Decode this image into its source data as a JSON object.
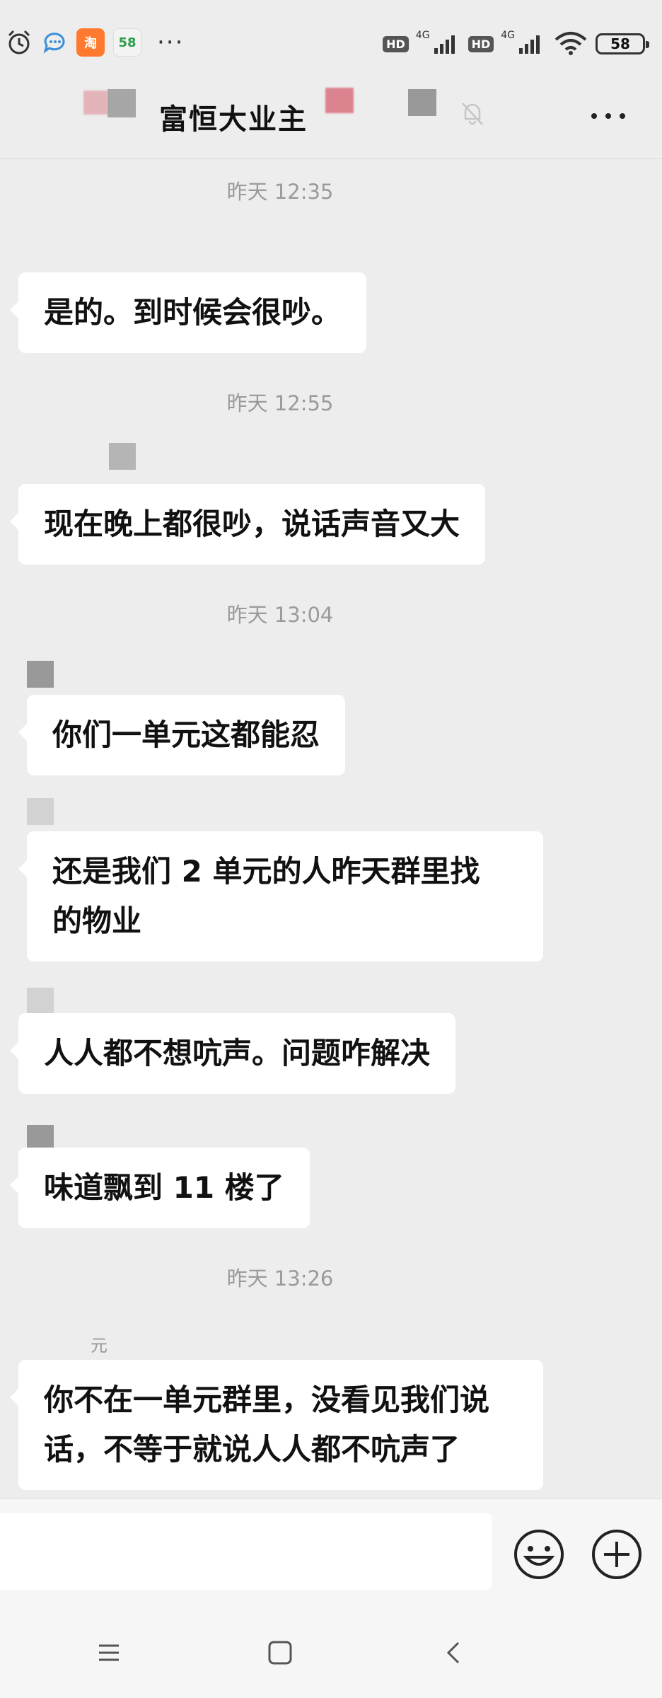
{
  "status_bar": {
    "app_icons": [
      "alarm-icon",
      "chat-bubble-icon",
      "taobao-icon",
      "58-icon"
    ],
    "taobao_label": "淘",
    "app58_label": "58",
    "more": "···",
    "hd1": "HD",
    "net1": "4G",
    "hd2": "HD",
    "net2": "4G",
    "battery": "58"
  },
  "header": {
    "title": "富恒大业主",
    "more_label": "more-options"
  },
  "messages": [
    {
      "type": "time",
      "text": "昨天 12:35"
    },
    {
      "type": "msg",
      "sender": "",
      "lines": [
        "是的。到时候会很吵。"
      ]
    },
    {
      "type": "time",
      "text": "昨天 12:55"
    },
    {
      "type": "msg",
      "sender": "",
      "lines": [
        "现在晚上都很吵，说话声音又大"
      ]
    },
    {
      "type": "time",
      "text": "昨天 13:04"
    },
    {
      "type": "msg",
      "sender": "",
      "lines": [
        "你们一单元这都能忍"
      ]
    },
    {
      "type": "msg",
      "sender": "",
      "lines": [
        "还是我们 2 单元的人昨天群里找",
        "的物业"
      ]
    },
    {
      "type": "msg",
      "sender": "",
      "lines": [
        "人人都不想吭声。问题咋解决"
      ]
    },
    {
      "type": "msg",
      "sender": "",
      "lines": [
        "味道飘到 11 楼了"
      ]
    },
    {
      "type": "time",
      "text": "昨天 13:26"
    },
    {
      "type": "msg",
      "sender": "元",
      "lines": [
        "你不在一单元群里，没看见我们说",
        "话，不等于就说人人都不吭声了"
      ]
    }
  ],
  "input": {
    "value": "",
    "placeholder": ""
  },
  "colors": {
    "background": "#ededed",
    "bubble": "#ffffff",
    "timestamp": "#9a9a9a",
    "taobao": "#ff7a2e",
    "app58": "#f3f3f3"
  }
}
